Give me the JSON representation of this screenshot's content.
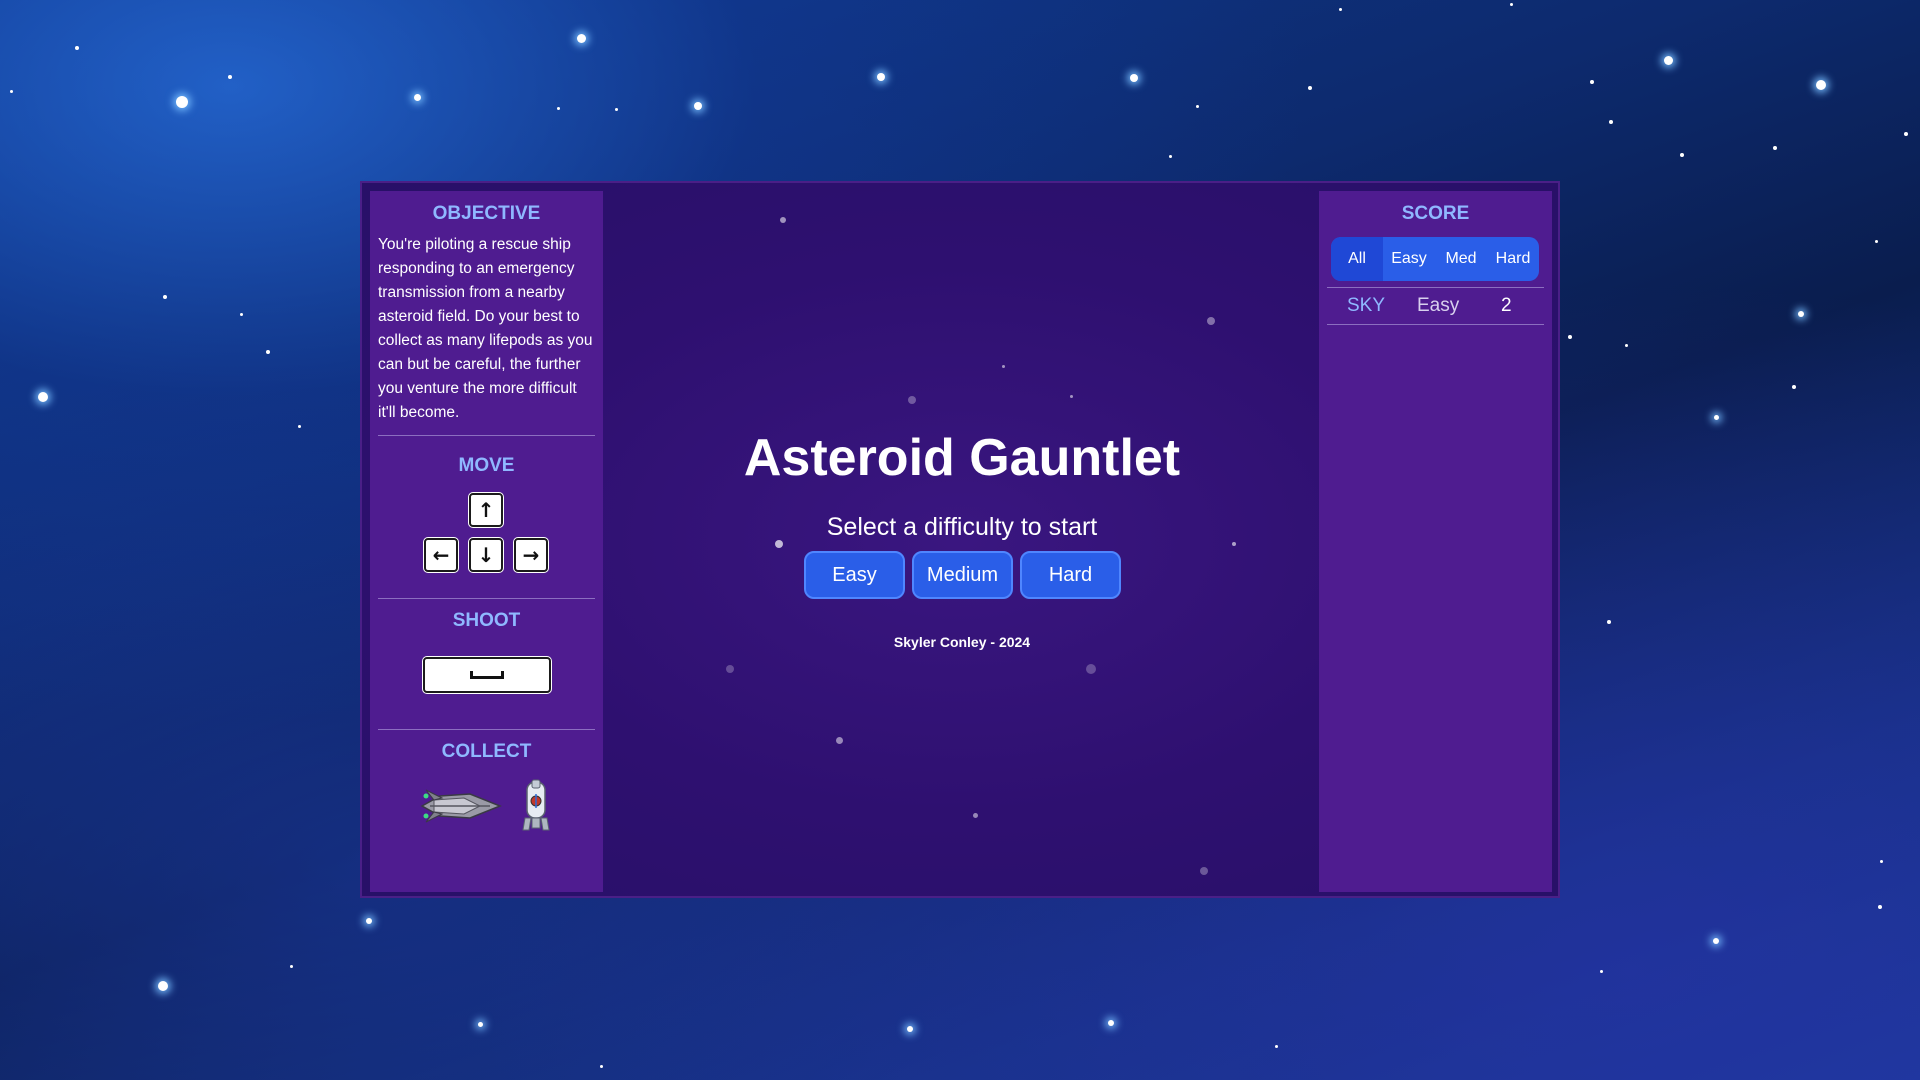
{
  "game": {
    "title": "Asteroid Gauntlet",
    "subtitle": "Select a difficulty to start",
    "difficulty_buttons": [
      "Easy",
      "Medium",
      "Hard"
    ],
    "credit": "Skyler Conley - 2024"
  },
  "left_panel": {
    "objective_heading": "OBJECTIVE",
    "objective_text": "You're piloting a rescue ship responding to an emergency transmission from a nearby asteroid field. Do your best to collect as many lifepods as you can but be careful, the further you venture the more difficult it'll become.",
    "move_heading": "MOVE",
    "move_keys": {
      "up": "↑",
      "left": "←",
      "down": "↓",
      "right": "→"
    },
    "shoot_heading": "SHOOT",
    "shoot_key_icon": "spacebar-icon",
    "collect_heading": "COLLECT",
    "collect_icons": [
      "rescue-ship-icon",
      "lifepod-icon"
    ]
  },
  "right_panel": {
    "score_heading": "SCORE",
    "filter_tabs": [
      "All",
      "Easy",
      "Med",
      "Hard"
    ],
    "active_tab": "All",
    "scores": [
      {
        "name": "SKY",
        "difficulty": "Easy",
        "score": "2"
      }
    ]
  },
  "colors": {
    "heading": "#8fb8ff",
    "panel": "#4f1c90",
    "button": "#2a5ee8",
    "score_name": "#8fb8ff"
  }
}
